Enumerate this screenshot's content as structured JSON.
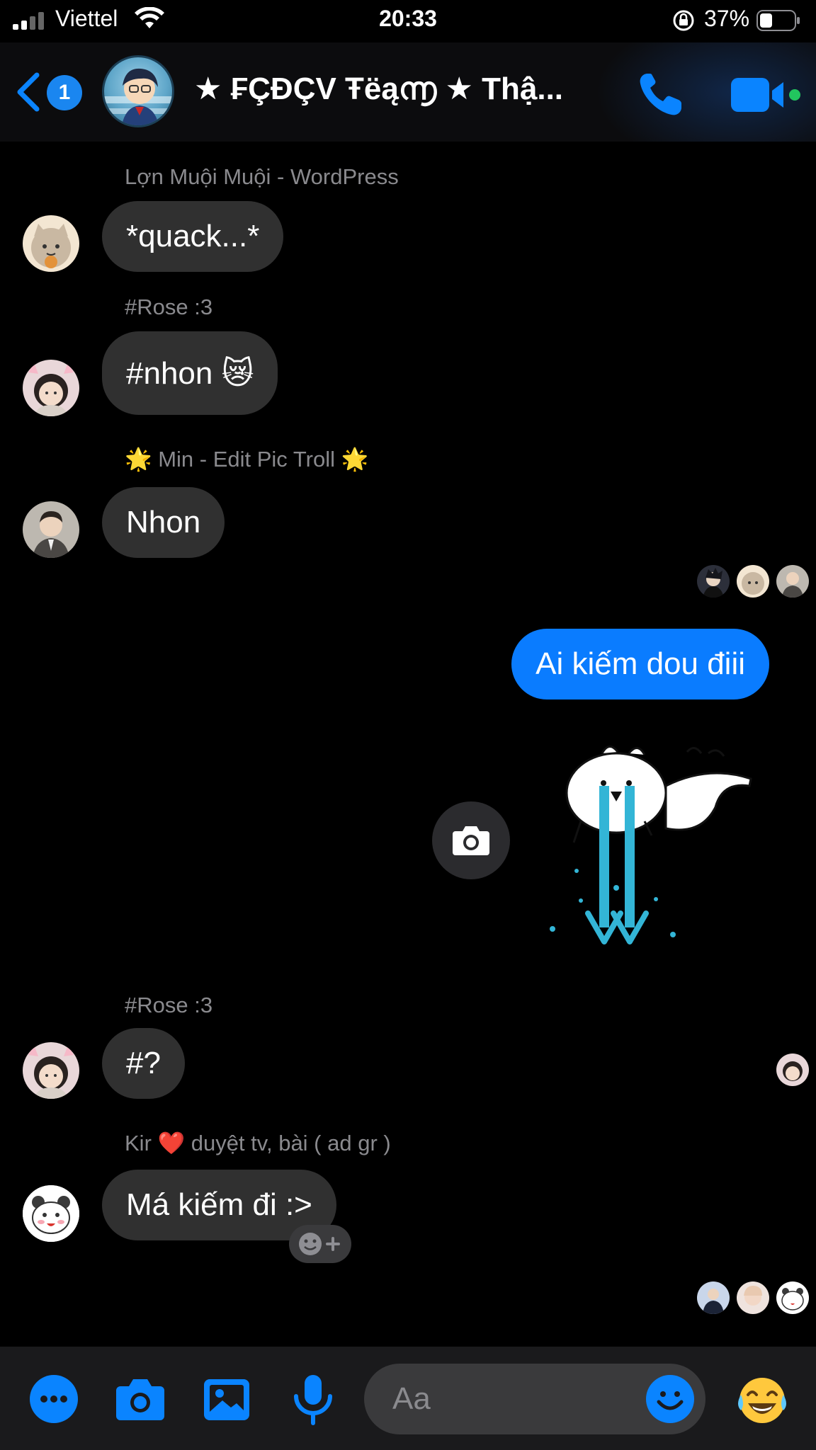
{
  "status_bar": {
    "carrier": "Viettel",
    "time": "20:33",
    "battery_percent": "37%",
    "battery_level": 0.37
  },
  "header": {
    "back_badge": "1",
    "title": "★ ₣ÇĐÇV Ŧëą൬ ★ Thậ...",
    "online_color": "#22c55e",
    "accent": "#0a84ff"
  },
  "messages": [
    {
      "sender": "Lợn Muội Muội - WordPress",
      "text": "*quack...*"
    },
    {
      "sender": "#Rose :3",
      "text": "#nhon 😿"
    },
    {
      "sender": "🌟 Min - Edit Pic Troll 🌟",
      "text": "Nhon"
    },
    {
      "outgoing": true,
      "text": "Ai kiếm dou điii"
    },
    {
      "sender": "#Rose :3",
      "text": "#?"
    },
    {
      "sender": "Kir ❤️ duyệt tv, bài ( ad gr )",
      "text": "Má kiếm đi :>"
    }
  ],
  "composer": {
    "placeholder": "Aa",
    "laugh_emoji": "😂"
  },
  "icons": {
    "back": "chevron-left-icon",
    "call": "phone-icon",
    "video": "video-camera-icon",
    "more": "more-icon",
    "camera": "camera-icon",
    "gallery": "image-icon",
    "mic": "microphone-icon",
    "emoji": "smile-icon",
    "reaction": "add-reaction-icon"
  }
}
